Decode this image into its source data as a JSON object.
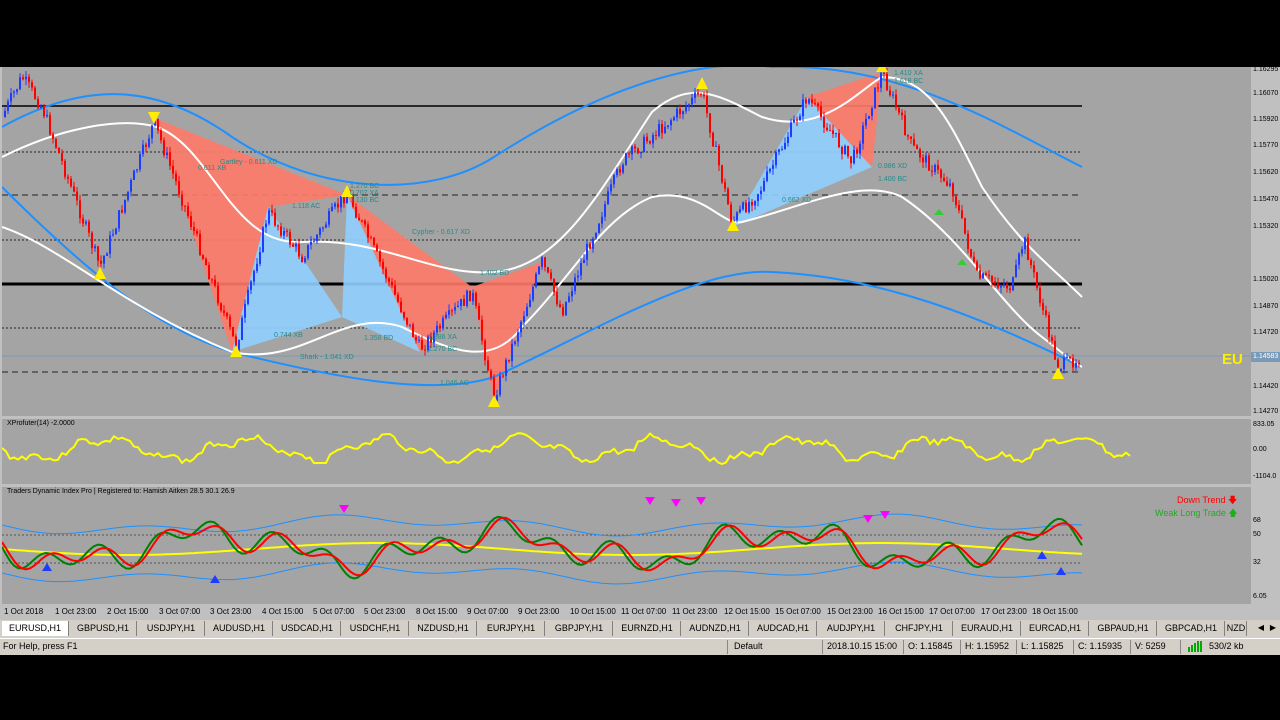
{
  "osc": {
    "title": "XProfuter(14) -2.0000",
    "axis": [
      "833.05",
      "0.00",
      "-1104.0"
    ]
  },
  "tdi": {
    "title": "Traders Dynamic Index Pro | Registered to: Hamish Aitken 28.5 30.1 26.9",
    "signal1": "Down Trend",
    "signal2": "Weak Long Trade",
    "axis": [
      "68",
      "50",
      "32",
      "6.05"
    ]
  },
  "main": {
    "symbol_badge": "EU",
    "current_price": "1.14583",
    "price_axis": [
      "1.16295",
      "1.16070",
      "1.15920",
      "1.15770",
      "1.15620",
      "1.15470",
      "1.15320",
      "1.15020",
      "1.14870",
      "1.14720",
      "1.14420",
      "1.14270"
    ],
    "pattern_labels": [
      "Gartley - 0.611 XD",
      "0.611 XB",
      "1.118 AC",
      "1.270 BC",
      "0.707 XA",
      "1.130 BC",
      "Cypher - 0.617 XD",
      "1.358 BD",
      "1.886 XA",
      "1.270 BC",
      "Shark - 1.041 XD",
      "1.046 AC",
      "0.744 XB",
      "1.402 BD",
      "1.410 XA",
      "1.618 BC",
      "0.886 XD",
      "1.400 BC",
      "0.662 XD"
    ]
  },
  "time_axis": [
    "1 Oct 2018",
    "1 Oct 23:00",
    "2 Oct 15:00",
    "3 Oct 07:00",
    "3 Oct 23:00",
    "4 Oct 15:00",
    "5 Oct 07:00",
    "5 Oct 23:00",
    "8 Oct 15:00",
    "9 Oct 07:00",
    "9 Oct 23:00",
    "10 Oct 15:00",
    "11 Oct 07:00",
    "11 Oct 23:00",
    "12 Oct 15:00",
    "15 Oct 07:00",
    "15 Oct 23:00",
    "16 Oct 15:00",
    "17 Oct 07:00",
    "17 Oct 23:00",
    "18 Oct 15:00"
  ],
  "tabs": [
    "EURUSD,H1",
    "GBPUSD,H1",
    "USDJPY,H1",
    "AUDUSD,H1",
    "USDCAD,H1",
    "USDCHF,H1",
    "NZDUSD,H1",
    "EURJPY,H1",
    "GBPJPY,H1",
    "EURNZD,H1",
    "AUDNZD,H1",
    "AUDCAD,H1",
    "AUDJPY,H1",
    "CHFJPY,H1",
    "EURAUD,H1",
    "EURCAD,H1",
    "GBPAUD,H1",
    "GBPCAD,H1",
    "NZD"
  ],
  "status": {
    "help": "For Help, press F1",
    "profile": "Default",
    "datetime": "2018.10.15 15:00",
    "open": "O: 1.15845",
    "high": "H: 1.15952",
    "low": "L: 1.15825",
    "close": "C: 1.15935",
    "volume": "V: 5259",
    "traffic": "530/2 kb"
  },
  "colors": {
    "bull_candle": "#1e3cff",
    "bear_candle": "#ff0000",
    "pattern_bear": "#ff7a6a",
    "pattern_bull": "#8fd0ff",
    "channel_blue": "#1e90ff",
    "envelope": "#ffffff",
    "osc_line": "#ffff00",
    "tdi_green": "#008000",
    "tdi_red": "#ff0000",
    "tdi_yellow": "#ffff00"
  }
}
